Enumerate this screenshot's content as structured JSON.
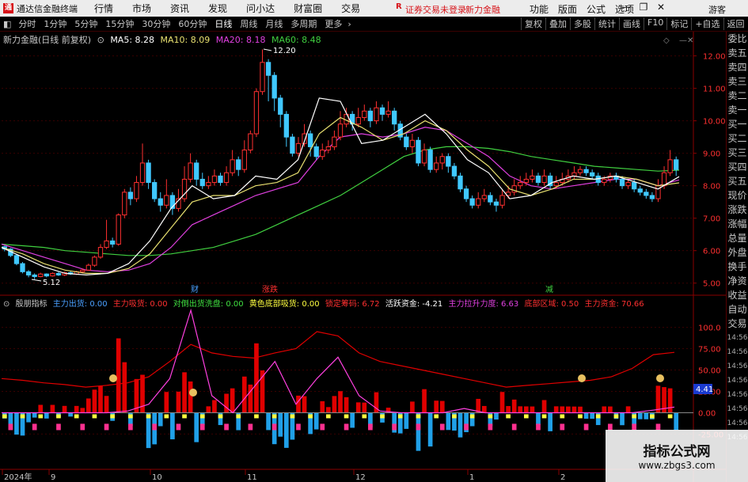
{
  "titlebar": {
    "app_title": "通达信金融终端",
    "menu": [
      "行情",
      "市场",
      "资讯",
      "发现",
      "问小达",
      "财富圈",
      "交易"
    ],
    "login_status": "证券交易未登录",
    "brand": "新力金融",
    "right_menu": [
      "功能",
      "版面",
      "公式",
      "选项"
    ],
    "guest": "游客"
  },
  "periodbar": {
    "periods": [
      "分时",
      "1分钟",
      "5分钟",
      "15分钟",
      "30分钟",
      "60分钟",
      "日线",
      "周线",
      "月线",
      "多周期",
      "更多"
    ],
    "active_period": "日线",
    "tools": [
      "复权",
      "叠加",
      "多股",
      "统计",
      "画线",
      "F10",
      "标记",
      "+自选",
      "返回"
    ]
  },
  "main_chart": {
    "stock_label": "新力金融(日线 前复权)",
    "ma": [
      {
        "label": "MA5: 8.28",
        "color": "#ffffff"
      },
      {
        "label": "MA10: 8.09",
        "color": "#e8e070"
      },
      {
        "label": "MA20: 8.18",
        "color": "#e040e0"
      },
      {
        "label": "MA60: 8.48",
        "color": "#40d040"
      }
    ],
    "high_label": "12.20",
    "low_label": "5.12",
    "price_ticks": [
      "12.00",
      "11.00",
      "10.00",
      "9.00",
      "8.00",
      "7.00",
      "6.00",
      "5.00"
    ],
    "event_marks": [
      "财",
      "减",
      "涨跌"
    ]
  },
  "indicator": {
    "name": "殷朋指标",
    "fields": [
      {
        "label": "主力出货: 0.00",
        "color": "#4aa0ff"
      },
      {
        "label": "主力吸货: 0.00",
        "color": "#ff3030"
      },
      {
        "label": "对倒出货洗盘: 0.00",
        "color": "#40e040"
      },
      {
        "label": "黄色底部吸货: 0.00",
        "color": "#ffff40"
      },
      {
        "label": "锁定筹码: 6.72",
        "color": "#ff3030"
      },
      {
        "label": "活跃资金: -4.21",
        "color": "#ffffff"
      },
      {
        "label": "主力拉升力度: 6.63",
        "color": "#e040e0"
      },
      {
        "label": "底部区域: 0.50",
        "color": "#ff3030"
      },
      {
        "label": "主力资金: 70.66",
        "color": "#ff3030"
      }
    ],
    "ticks": [
      "100.0",
      "75.00",
      "50.00",
      "25.00",
      "0.00",
      "-25.00"
    ],
    "current_value": "4.41"
  },
  "date_axis": [
    "2024年",
    "9",
    "10",
    "11",
    "12",
    "1",
    "2"
  ],
  "right_panel_items": [
    "委比",
    "卖五",
    "卖四",
    "卖三",
    "卖二",
    "卖一",
    "买一",
    "买二",
    "买三",
    "买四",
    "买五",
    "现价",
    "涨跌",
    "涨幅",
    "总量",
    "外盘",
    "换手",
    "净资",
    "收益",
    "自动",
    "交易"
  ],
  "right_panel_times": [
    "14:56",
    "14:56",
    "14:56",
    "14:56",
    "14:56",
    "14:56",
    "14:56",
    "14:56"
  ],
  "watermark": {
    "line1": "指标公式网",
    "line2": "www.zbgs3.com"
  },
  "chart_data": {
    "type": "candlestick",
    "price_range": [
      4.7,
      12.6
    ],
    "candles": [
      [
        6.12,
        6.05,
        6.15,
        5.98
      ],
      [
        6.05,
        5.85,
        6.08,
        5.8
      ],
      [
        5.85,
        5.6,
        5.9,
        5.55
      ],
      [
        5.6,
        5.35,
        5.65,
        5.3
      ],
      [
        5.35,
        5.25,
        5.4,
        5.18
      ],
      [
        5.25,
        5.2,
        5.3,
        5.12
      ],
      [
        5.2,
        5.28,
        5.32,
        5.18
      ],
      [
        5.28,
        5.22,
        5.3,
        5.18
      ],
      [
        5.22,
        5.3,
        5.33,
        5.2
      ],
      [
        5.3,
        5.25,
        5.34,
        5.22
      ],
      [
        5.25,
        5.32,
        5.35,
        5.22
      ],
      [
        5.32,
        5.28,
        5.36,
        5.25
      ],
      [
        5.28,
        5.35,
        5.38,
        5.25
      ],
      [
        5.35,
        5.4,
        5.45,
        5.3
      ],
      [
        5.4,
        5.55,
        5.6,
        5.38
      ],
      [
        5.55,
        5.8,
        5.85,
        5.5
      ],
      [
        5.8,
        6.1,
        6.2,
        5.75
      ],
      [
        6.1,
        6.3,
        6.95,
        6.05
      ],
      [
        6.3,
        6.2,
        6.4,
        6.1
      ],
      [
        6.2,
        7.1,
        7.15,
        6.15
      ],
      [
        7.1,
        7.8,
        7.9,
        7.0
      ],
      [
        7.8,
        7.6,
        7.95,
        7.4
      ],
      [
        7.6,
        8.1,
        8.3,
        7.5
      ],
      [
        8.1,
        8.7,
        9.3,
        8.0
      ],
      [
        8.7,
        8.1,
        8.8,
        7.9
      ],
      [
        8.1,
        7.6,
        8.2,
        7.5
      ],
      [
        7.6,
        7.4,
        7.8,
        7.2
      ],
      [
        7.4,
        7.7,
        8.2,
        7.3
      ],
      [
        7.7,
        7.3,
        7.8,
        7.1
      ],
      [
        7.3,
        7.6,
        7.9,
        7.2
      ],
      [
        7.6,
        8.2,
        8.6,
        7.5
      ],
      [
        8.2,
        8.7,
        9.0,
        8.1
      ],
      [
        8.7,
        8.2,
        8.8,
        8.0
      ],
      [
        8.2,
        8.0,
        8.4,
        7.9
      ],
      [
        8.0,
        8.1,
        8.3,
        7.9
      ],
      [
        8.1,
        8.3,
        8.5,
        8.0
      ],
      [
        8.3,
        8.1,
        8.4,
        8.0
      ],
      [
        8.1,
        8.4,
        8.6,
        8.0
      ],
      [
        8.4,
        8.8,
        9.1,
        8.3
      ],
      [
        8.8,
        8.5,
        8.9,
        8.3
      ],
      [
        8.5,
        9.1,
        9.4,
        8.4
      ],
      [
        9.1,
        9.6,
        9.7,
        9.0
      ],
      [
        9.6,
        10.9,
        11.0,
        9.5
      ],
      [
        10.9,
        11.8,
        12.2,
        10.8
      ],
      [
        11.8,
        11.4,
        11.9,
        10.6
      ],
      [
        11.4,
        10.7,
        11.5,
        10.3
      ],
      [
        10.7,
        10.2,
        10.8,
        9.8
      ],
      [
        10.2,
        9.5,
        10.3,
        9.2
      ],
      [
        9.5,
        9.0,
        9.6,
        8.9
      ],
      [
        9.0,
        9.3,
        9.5,
        8.9
      ],
      [
        9.3,
        9.6,
        9.9,
        9.2
      ],
      [
        9.6,
        9.2,
        9.7,
        8.9
      ],
      [
        9.2,
        8.9,
        9.3,
        8.8
      ],
      [
        8.9,
        9.1,
        9.3,
        8.8
      ],
      [
        9.1,
        9.2,
        9.4,
        9.0
      ],
      [
        9.2,
        9.5,
        9.7,
        9.1
      ],
      [
        9.5,
        9.9,
        10.3,
        9.4
      ],
      [
        9.9,
        10.2,
        10.4,
        9.8
      ],
      [
        10.2,
        9.9,
        10.3,
        9.7
      ],
      [
        9.9,
        10.1,
        10.4,
        9.8
      ],
      [
        10.1,
        10.3,
        10.5,
        10.0
      ],
      [
        10.3,
        10.0,
        10.4,
        9.8
      ],
      [
        10.0,
        10.4,
        10.6,
        9.9
      ],
      [
        10.4,
        10.2,
        10.5,
        10.0
      ],
      [
        10.2,
        10.3,
        10.6,
        10.1
      ],
      [
        10.3,
        9.9,
        10.4,
        9.7
      ],
      [
        9.9,
        9.5,
        10.0,
        9.4
      ],
      [
        9.5,
        9.2,
        9.6,
        9.1
      ],
      [
        9.2,
        9.4,
        9.6,
        9.0
      ],
      [
        9.4,
        8.7,
        9.5,
        8.6
      ],
      [
        8.7,
        9.1,
        9.3,
        8.6
      ],
      [
        9.1,
        8.5,
        9.2,
        8.4
      ],
      [
        8.5,
        8.7,
        8.9,
        8.4
      ],
      [
        8.7,
        8.9,
        9.0,
        8.5
      ],
      [
        8.9,
        8.6,
        9.0,
        8.4
      ],
      [
        8.6,
        8.3,
        8.7,
        8.2
      ],
      [
        8.3,
        7.9,
        8.4,
        7.8
      ],
      [
        7.9,
        7.6,
        8.0,
        7.5
      ],
      [
        7.6,
        7.4,
        7.7,
        7.3
      ],
      [
        7.4,
        7.6,
        7.8,
        7.3
      ],
      [
        7.6,
        7.7,
        7.9,
        7.5
      ],
      [
        7.7,
        7.5,
        7.8,
        7.4
      ],
      [
        7.5,
        7.4,
        7.6,
        7.2
      ],
      [
        7.4,
        7.7,
        7.9,
        7.3
      ],
      [
        7.7,
        7.8,
        8.0,
        7.6
      ],
      [
        7.8,
        8.0,
        8.2,
        7.7
      ],
      [
        8.0,
        8.1,
        8.3,
        7.9
      ],
      [
        8.1,
        8.2,
        8.4,
        8.0
      ],
      [
        8.2,
        8.3,
        8.5,
        8.1
      ],
      [
        8.3,
        8.1,
        8.4,
        8.0
      ],
      [
        8.1,
        8.3,
        8.5,
        8.0
      ],
      [
        8.3,
        8.0,
        8.4,
        7.9
      ],
      [
        8.0,
        8.1,
        8.3,
        7.9
      ],
      [
        8.1,
        8.2,
        8.4,
        8.0
      ],
      [
        8.2,
        8.3,
        8.5,
        8.1
      ],
      [
        8.3,
        8.4,
        8.6,
        8.2
      ],
      [
        8.4,
        8.5,
        8.6,
        8.3
      ],
      [
        8.5,
        8.4,
        8.6,
        8.3
      ],
      [
        8.4,
        8.3,
        8.5,
        8.2
      ],
      [
        8.3,
        8.1,
        8.4,
        8.0
      ],
      [
        8.1,
        8.2,
        8.3,
        8.0
      ],
      [
        8.2,
        8.3,
        8.4,
        8.1
      ],
      [
        8.3,
        8.2,
        8.4,
        8.1
      ],
      [
        8.2,
        8.0,
        8.3,
        7.9
      ],
      [
        8.0,
        8.1,
        8.2,
        7.9
      ],
      [
        8.1,
        7.9,
        8.2,
        7.8
      ],
      [
        7.9,
        7.8,
        8.0,
        7.7
      ],
      [
        7.8,
        7.7,
        7.9,
        7.6
      ],
      [
        7.7,
        7.6,
        7.8,
        7.5
      ],
      [
        7.6,
        8.0,
        8.2,
        7.5
      ],
      [
        8.0,
        8.4,
        8.6,
        7.9
      ],
      [
        8.4,
        8.8,
        9.1,
        8.3
      ],
      [
        8.8,
        8.5,
        8.9,
        8.3
      ]
    ],
    "ma5_sample": [
      6.1,
      5.8,
      5.5,
      5.3,
      5.25,
      5.3,
      5.6,
      6.3,
      7.3,
      8.0,
      7.6,
      7.7,
      8.3,
      8.2,
      8.8,
      10.7,
      10.6,
      9.3,
      9.4,
      9.8,
      10.2,
      9.6,
      8.8,
      8.4,
      7.6,
      7.7,
      8.1,
      8.3,
      8.2,
      8.3,
      8.1,
      7.9,
      8.28
    ],
    "ma10_sample": [
      6.1,
      5.9,
      5.6,
      5.4,
      5.3,
      5.3,
      5.45,
      5.9,
      6.7,
      7.5,
      7.7,
      7.7,
      8.0,
      8.1,
      8.4,
      9.6,
      10.1,
      9.8,
      9.4,
      9.6,
      10.0,
      9.7,
      9.1,
      8.6,
      7.9,
      7.7,
      7.9,
      8.2,
      8.2,
      8.3,
      8.2,
      8.0,
      8.09
    ],
    "ma20_sample": [
      6.2,
      6.0,
      5.8,
      5.6,
      5.4,
      5.35,
      5.4,
      5.6,
      6.1,
      6.8,
      7.1,
      7.4,
      7.7,
      7.9,
      8.1,
      8.9,
      9.5,
      9.6,
      9.5,
      9.6,
      9.8,
      9.7,
      9.3,
      8.9,
      8.3,
      8.0,
      7.9,
      8.0,
      8.1,
      8.2,
      8.2,
      8.0,
      8.18
    ],
    "ma60_sample": [
      6.2,
      6.15,
      6.1,
      6.0,
      5.95,
      5.9,
      5.85,
      5.85,
      5.9,
      6.0,
      6.1,
      6.3,
      6.5,
      6.8,
      7.1,
      7.4,
      7.7,
      8.1,
      8.5,
      8.9,
      9.1,
      9.2,
      9.2,
      9.15,
      9.05,
      8.9,
      8.8,
      8.7,
      8.6,
      8.55,
      8.5,
      8.45,
      8.48
    ],
    "indicator_red_line": [
      40,
      38,
      35,
      33,
      30,
      32,
      35,
      42,
      60,
      80,
      70,
      66,
      64,
      70,
      75,
      95,
      90,
      70,
      60,
      55,
      50,
      45,
      40,
      35,
      30,
      32,
      34,
      36,
      38,
      42,
      52,
      68,
      70.66
    ],
    "indicator_magenta_line": [
      0,
      0,
      0,
      0,
      0,
      0,
      2,
      10,
      40,
      120,
      20,
      0,
      30,
      60,
      10,
      40,
      65,
      20,
      2,
      0,
      0,
      0,
      5,
      0,
      0,
      0,
      0,
      0,
      0,
      0,
      0,
      3,
      6.63
    ],
    "indicator_range": [
      -45,
      120
    ]
  }
}
